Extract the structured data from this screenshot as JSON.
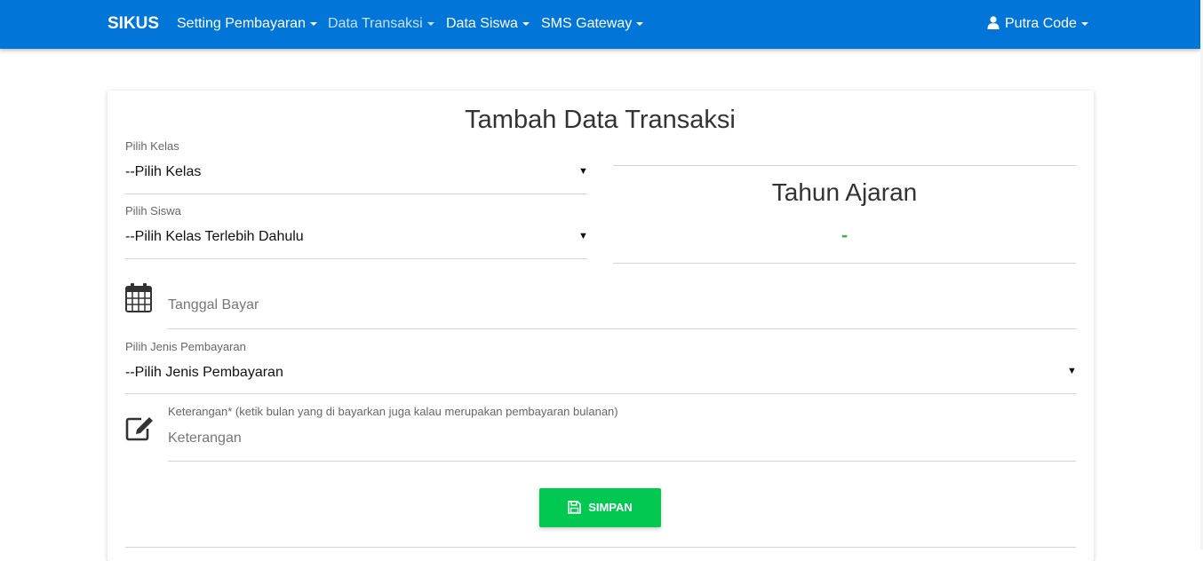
{
  "navbar": {
    "brand": "SIKUS",
    "items": [
      {
        "label": "Setting Pembayaran"
      },
      {
        "label": "Data Transaksi"
      },
      {
        "label": "Data Siswa"
      },
      {
        "label": "SMS Gateway"
      }
    ],
    "user": "Putra Code",
    "color": "#0275d8"
  },
  "form": {
    "title": "Tambah Data Transaksi",
    "kelas": {
      "label": "Pilih Kelas",
      "value": "--Pilih Kelas"
    },
    "siswa": {
      "label": "Pilih Siswa",
      "value": "--Pilih Kelas Terlebih Dahulu"
    },
    "tanggal": {
      "placeholder": "Tanggal Bayar",
      "icon": "calendar-icon"
    },
    "jenis": {
      "label": "Pilih Jenis Pembayaran",
      "value": "--Pilih Jenis Pembayaran"
    },
    "keterangan": {
      "label": "Keterangan* (ketik bulan yang di bayarkan juga kalau merupakan pembayaran bulanan)",
      "placeholder": "Keterangan",
      "icon": "edit-icon"
    },
    "submit": {
      "label": "SIMPAN",
      "icon": "save-icon",
      "color": "#00c851"
    }
  },
  "tahun_ajaran": {
    "title": "Tahun Ajaran",
    "value": "-",
    "value_color": "#4caf50"
  }
}
